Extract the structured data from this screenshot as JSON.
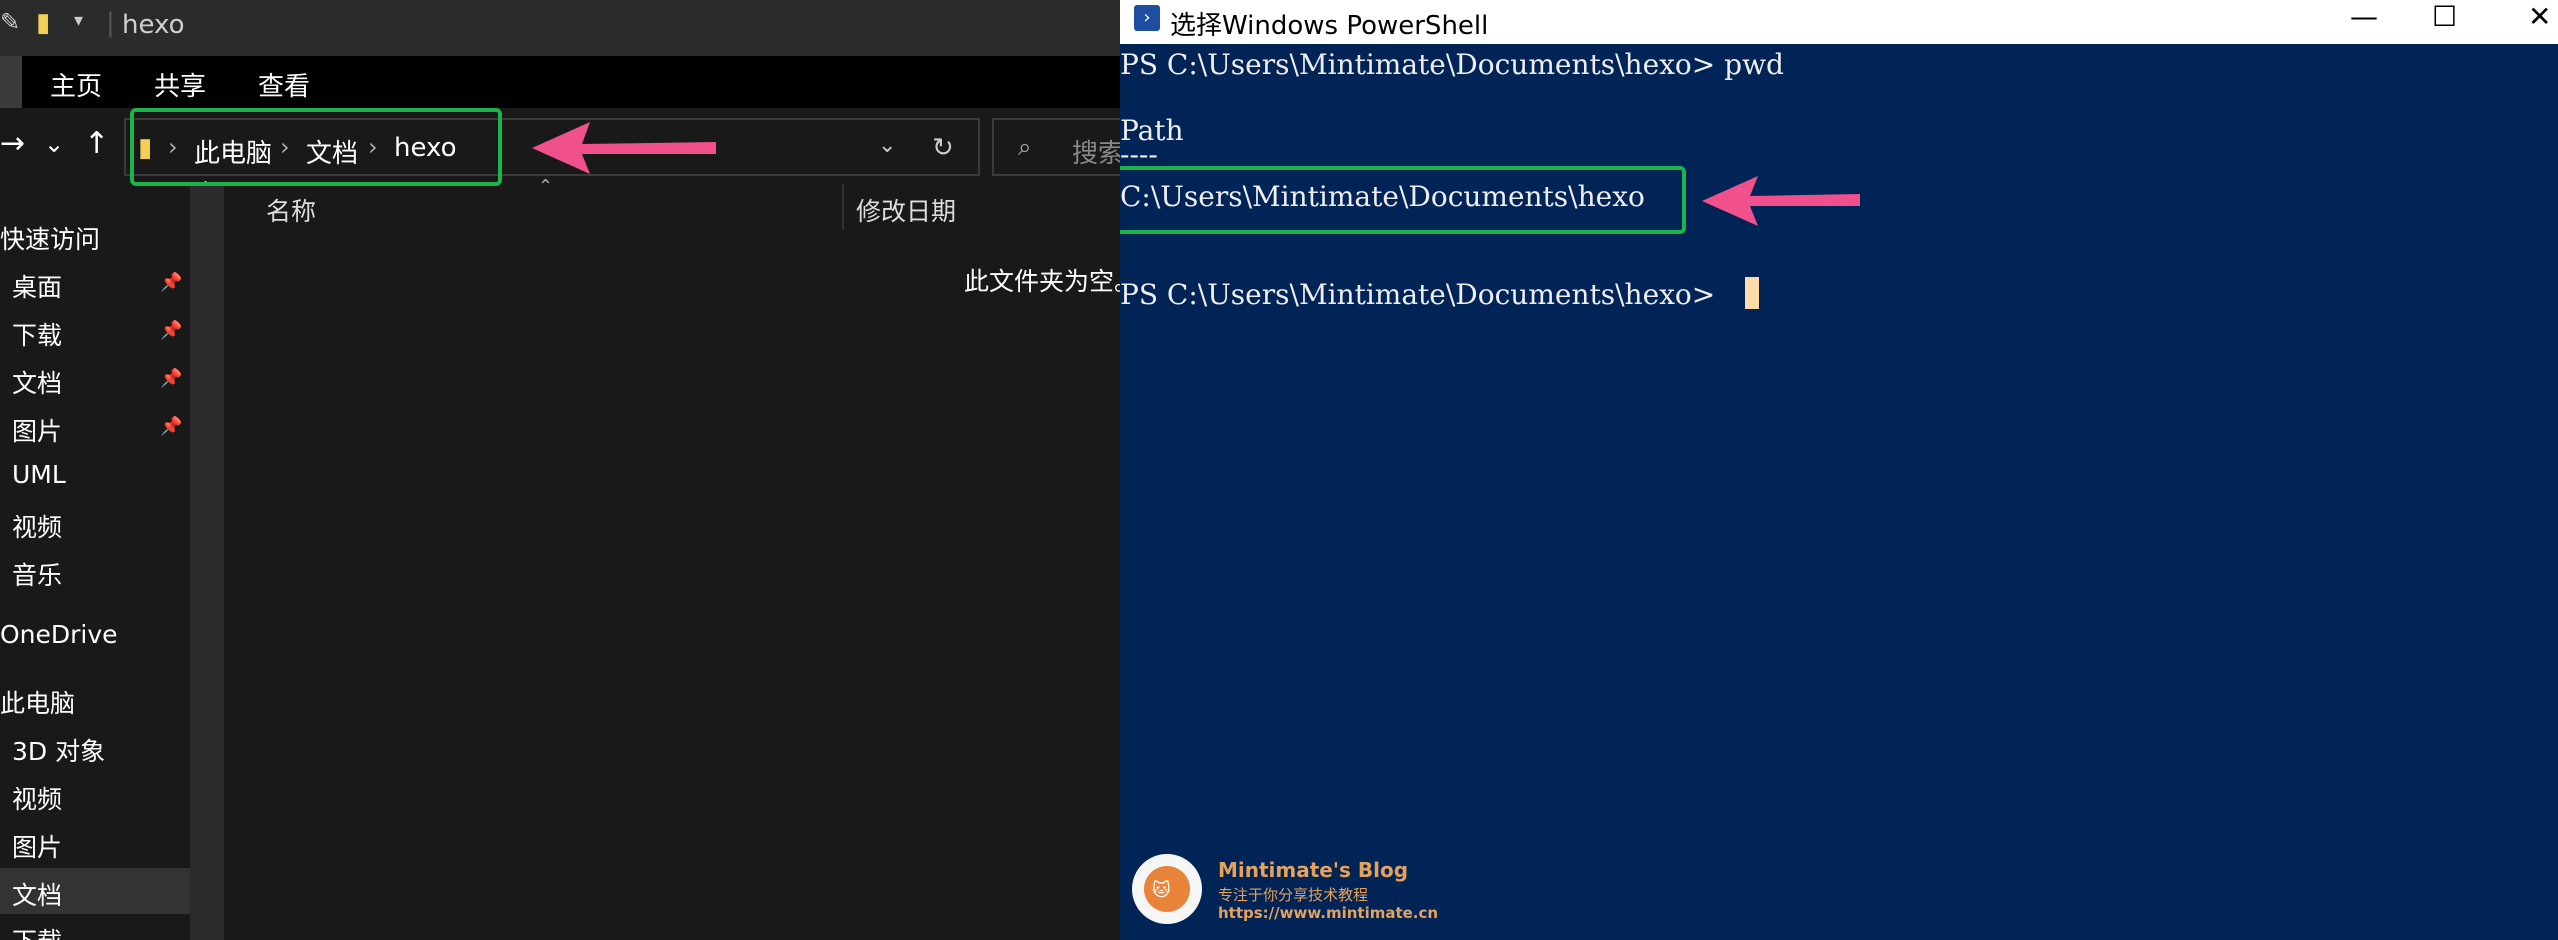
{
  "explorer": {
    "title": "hexo",
    "ribbon_tabs": [
      "主页",
      "共享",
      "查看"
    ],
    "breadcrumb": [
      "此电脑",
      "文档",
      "hexo"
    ],
    "search_placeholder": "搜索",
    "columns": {
      "name": "名称",
      "modified": "修改日期"
    },
    "empty_message": "此文件夹为空。",
    "sidebar": [
      {
        "label": "快速访问",
        "pinned": false
      },
      {
        "label": "桌面",
        "pinned": true
      },
      {
        "label": "下载",
        "pinned": true
      },
      {
        "label": "文档",
        "pinned": true
      },
      {
        "label": "图片",
        "pinned": true
      },
      {
        "label": "UML",
        "pinned": false
      },
      {
        "label": "视频",
        "pinned": false
      },
      {
        "label": "音乐",
        "pinned": false
      },
      {
        "label": "OneDrive",
        "pinned": false
      },
      {
        "label": "此电脑",
        "pinned": false
      },
      {
        "label": "3D 对象",
        "pinned": false
      },
      {
        "label": "视频",
        "pinned": false
      },
      {
        "label": "图片",
        "pinned": false
      },
      {
        "label": "文档",
        "pinned": false
      },
      {
        "label": "下载",
        "pinned": false
      }
    ]
  },
  "powershell": {
    "title": "选择Windows PowerShell",
    "window_buttons": {
      "minimize": "—",
      "maximize": "☐",
      "close": "✕"
    },
    "lines": [
      "PS C:\\Users\\Mintimate\\Documents\\hexo> pwd",
      "Path",
      "----",
      "C:\\Users\\Mintimate\\Documents\\hexo",
      "PS C:\\Users\\Mintimate\\Documents\\hexo> "
    ]
  },
  "watermark": {
    "title": "Mintimate's Blog",
    "subtitle": "专注于你分享技术教程",
    "url": "https://www.mintimate.cn"
  },
  "colors": {
    "highlight_box": "#1db34a",
    "arrow": "#f0508c",
    "ps_background": "#012456"
  }
}
